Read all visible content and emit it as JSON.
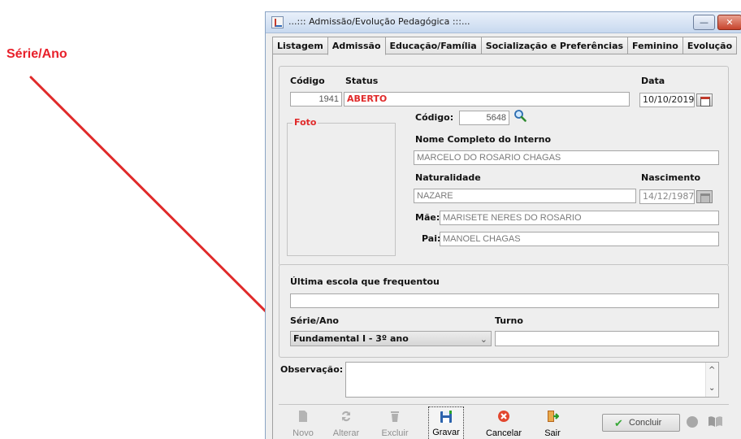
{
  "annotation": {
    "label": "Série/Ano"
  },
  "window": {
    "title": "...::: Admissão/Evolução Pedagógica :::..."
  },
  "tabs": [
    "Listagem",
    "Admissão",
    "Educação/Família",
    "Socialização e Preferências",
    "Feminino",
    "Evolução"
  ],
  "header": {
    "codigo_label": "Código",
    "codigo_value": "1941",
    "status_label": "Status",
    "status_value": "ABERTO",
    "data_label": "Data",
    "data_value": "10/10/2019"
  },
  "interno": {
    "foto_label": "Foto",
    "codigo_label": "Código:",
    "codigo_value": "5648",
    "nome_label": "Nome Completo do Interno",
    "nome_value": "MARCELO DO ROSARIO CHAGAS",
    "naturalidade_label": "Naturalidade",
    "naturalidade_value": "NAZARE",
    "nascimento_label": "Nascimento",
    "nascimento_value": "14/12/1987",
    "mae_label": "Mãe:",
    "mae_value": "MARISETE NERES DO ROSARIO",
    "pai_label": "Pai:",
    "pai_value": "MANOEL CHAGAS"
  },
  "escola": {
    "ultima_label": "Última escola que frequentou",
    "ultima_value": "",
    "serie_label": "Série/Ano",
    "serie_value": "Fundamental I - 3º ano",
    "turno_label": "Turno",
    "turno_value": ""
  },
  "observacao": {
    "label": "Observação:",
    "value": ""
  },
  "toolbar": {
    "novo": "Novo",
    "alterar": "Alterar",
    "excluir": "Excluir",
    "gravar": "Gravar",
    "cancelar": "Cancelar",
    "sair": "Sair",
    "concluir": "Concluir"
  },
  "colors": {
    "accent_red": "#e02a2a",
    "annotation_red": "#e8202a"
  }
}
